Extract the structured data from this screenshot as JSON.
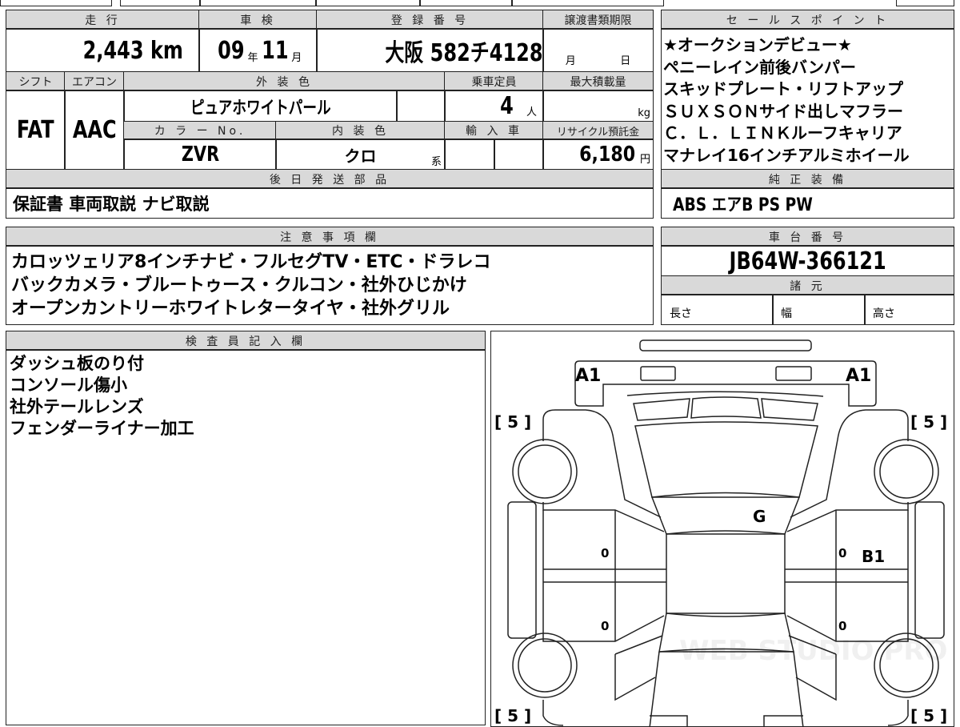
{
  "mileage": {
    "label": "走 行",
    "value": "2,443",
    "unit": "km"
  },
  "inspection": {
    "label": "車 検",
    "year": "09",
    "year_unit": "年",
    "month": "11",
    "month_unit": "月"
  },
  "registration": {
    "label": "登 録 番 号",
    "value": "大阪 582チ4128"
  },
  "transfer_deadline": {
    "label": "譲渡書類期限",
    "month_unit": "月",
    "day_unit": "日"
  },
  "shift": {
    "label": "シフト",
    "value": "FAT"
  },
  "aircon": {
    "label": "エアコン",
    "value": "AAC"
  },
  "exterior_color": {
    "label": "外 装 色",
    "value": "ピュアホワイトパール"
  },
  "capacity": {
    "label": "乗車定員",
    "value": "4",
    "unit": "人"
  },
  "max_load": {
    "label": "最大積載量",
    "unit": "kg"
  },
  "color_no": {
    "label": "カ ラ ー No.",
    "value": "ZVR"
  },
  "interior_color": {
    "label": "内 装 色",
    "value": "クロ",
    "suffix": "系"
  },
  "import": {
    "label": "輸 入 車"
  },
  "recycle_fee": {
    "label": "リサイクル預託金",
    "value": "6,180",
    "unit": "円"
  },
  "later_parts": {
    "label": "後 日 発 送 部 品",
    "value": "保証書 車両取説 ナビ取説"
  },
  "sales_points": {
    "label": "セ ー ル ス ポ イ ン ト",
    "items": [
      "★オークションデビュー★",
      "ペニーレイン前後バンパー",
      "スキッドプレート・リフトアップ",
      "ＳＵＸＳＯＮサイド出しマフラー",
      "Ｃ．Ｌ．ＬＩＮＫルーフキャリア",
      "マナレイ16インチアルミホイール"
    ]
  },
  "standard_equipment": {
    "label": "純 正 装 備",
    "value": "ABS エアB PS PW"
  },
  "notes": {
    "label": "注 意 事 項 欄",
    "items": [
      "カロッツェリア8インチナビ・フルセグTV・ETC・ドラレコ",
      "バックカメラ・ブルートゥース・クルコン・社外ひじかけ",
      "オープンカントリーホワイトレタータイヤ・社外グリル"
    ]
  },
  "chassis": {
    "label": "車 台 番 号",
    "value": "JB64W-366121"
  },
  "specs": {
    "label": "諸 元",
    "length": "長さ",
    "width": "幅",
    "height": "高さ"
  },
  "inspector": {
    "label": "検 査 員 記 入 欄",
    "items": [
      "ダッシュ板のり付",
      "コンソール傷小",
      "社外テールレンズ",
      "フェンダーライナー加工"
    ]
  },
  "diagram": {
    "marks": {
      "front_left": "A1",
      "front_right": "A1",
      "roof": "G",
      "right_door": "B1",
      "door_zero": "0"
    },
    "tire_label": "[ 5 ]",
    "watermark": "WEB STUDIO PRO"
  }
}
